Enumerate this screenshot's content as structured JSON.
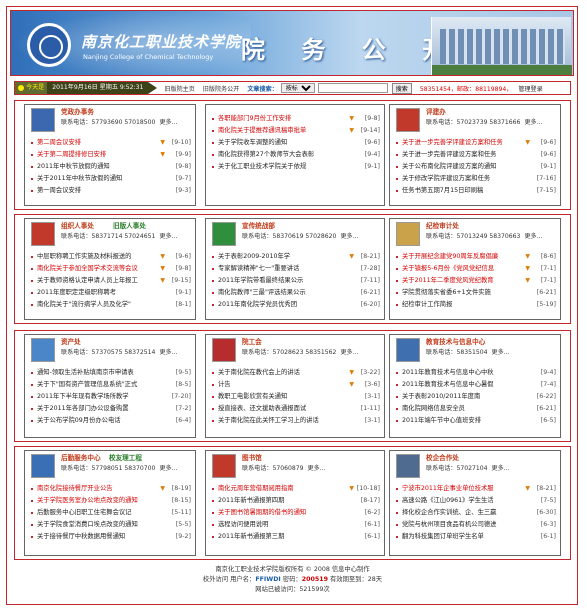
{
  "banner": {
    "school_cn": "南京化工职业技术学院",
    "school_en": "Nanjing College of Chemical Technology",
    "title": "院 务 公 开"
  },
  "navbar": {
    "today_label": "今天是",
    "date": "2011年9月16日 星期五 9:52:31",
    "links": [
      "旧版院主页",
      "旧版院务公开"
    ],
    "search_label": "文章搜索：",
    "select_value": "按标题",
    "search_button": "搜索",
    "stats": "58351454，邮政：88119894，",
    "admin": "管理登录"
  },
  "panels": [
    {
      "id": "a",
      "title": "党政办事务",
      "phone": "联系电话：57793690  57018500",
      "more": "更多...",
      "items": [
        {
          "t": "第二周会议安排",
          "d": "[9-10]",
          "hot": true,
          "flag": true
        },
        {
          "t": "关于第二周提排修日安排",
          "d": "[9-9]",
          "hot": true,
          "flag": true
        },
        {
          "t": "2011年中秋节放假的通知",
          "d": "[9-8]",
          "hot": false,
          "flag": false
        },
        {
          "t": "关于2011年中秋节放假的通知",
          "d": "[9-7]",
          "hot": false,
          "flag": false
        },
        {
          "t": "第一周会议安排",
          "d": "[9-3]",
          "hot": false,
          "flag": false
        }
      ]
    },
    {
      "id": "b",
      "title": "",
      "phone": "",
      "more": "",
      "items": [
        {
          "t": "各职能部门9月份工作安排",
          "d": "[9-8]",
          "hot": true,
          "flag": true
        },
        {
          "t": "南化院关于提推荐通讯稿审批单",
          "d": "[9-14]",
          "hot": true,
          "flag": true
        },
        {
          "t": "关于学院收车调整的通知",
          "d": "[9-6]",
          "hot": false,
          "flag": false
        },
        {
          "t": "南化院获得第27个教师节大会表彰",
          "d": "[9-4]",
          "hot": false,
          "flag": false
        },
        {
          "t": "关于化工职业技术学院关于依规",
          "d": "[9-1]",
          "hot": false,
          "flag": false
        }
      ]
    },
    {
      "id": "c",
      "title": "评建办",
      "phone": "联系电话：57023739  58371666",
      "more": "更多...",
      "items": [
        {
          "t": "关于进一步完善学评建设方案和任务",
          "d": "[9-6]",
          "hot": true,
          "flag": true
        },
        {
          "t": "关于进一步完善评建设方案和任务",
          "d": "[9-6]",
          "hot": false,
          "flag": false
        },
        {
          "t": "关于公布南化院评建设方案的通知",
          "d": "[9-1]",
          "hot": false,
          "flag": false
        },
        {
          "t": "关于修改学院评建设方案和任务",
          "d": "[7-16]",
          "hot": false,
          "flag": false
        },
        {
          "t": "任务书第五期7月15日印刷稿",
          "d": "[7-15]",
          "hot": false,
          "flag": false
        }
      ]
    },
    {
      "id": "d",
      "title": "组织人事处",
      "title2": "旧版人事处",
      "phone": "联系电话：58371714  57024651",
      "more": "更多...",
      "items": [
        {
          "t": "中层职称聘工作实施及材料报送的",
          "d": "[9-6]",
          "hot": false,
          "flag": true
        },
        {
          "t": "南化院关于参加全国学术交流等会议",
          "d": "[9-8]",
          "hot": true,
          "flag": true
        },
        {
          "t": "关于教师资格认定申请人员上年报工",
          "d": "[9-15]",
          "hot": false,
          "flag": true
        },
        {
          "t": "2011年度职定定级职称聘考",
          "d": "[9-1]",
          "hot": false,
          "flag": false
        },
        {
          "t": "南化院关于\"流行病学人员及化学\"",
          "d": "[8-1]",
          "hot": false,
          "flag": false
        }
      ]
    },
    {
      "id": "e",
      "title": "宣传统战部",
      "phone": "联系电话：58370619  57028620",
      "more": "更多...",
      "items": [
        {
          "t": "关于表彰2009-2010年学",
          "d": "[8-21]",
          "hot": false,
          "flag": true
        },
        {
          "t": "专家解读精神\"七一\"重要讲话",
          "d": "[7-28]",
          "hot": false,
          "flag": false
        },
        {
          "t": "2011年学院带看最终结果公示",
          "d": "[7-11]",
          "hot": false,
          "flag": false
        },
        {
          "t": "南化院教师\"三最\"评选结果公示",
          "d": "[6-21]",
          "hot": false,
          "flag": false
        },
        {
          "t": "2011年南化院学党员优秀团",
          "d": "[6-20]",
          "hot": false,
          "flag": false
        }
      ]
    },
    {
      "id": "f",
      "title": "纪检审计处",
      "phone": "联系电话：57013249  58370663",
      "more": "更多...",
      "items": [
        {
          "t": "关于开展纪念建党90周年反腐倡廉",
          "d": "[8-6]",
          "hot": true,
          "flag": true
        },
        {
          "t": "关于镇报5-6月份《党风党纪信息",
          "d": "[7-1]",
          "hot": true,
          "flag": true
        },
        {
          "t": "关于2011年二季度党风党纪教育",
          "d": "[7-1]",
          "hot": true,
          "flag": true
        },
        {
          "t": "学院贯彻落实省委6+1文件实施",
          "d": "[6-21]",
          "hot": false,
          "flag": false
        },
        {
          "t": "纪检审计工作简报",
          "d": "[5-19]",
          "hot": false,
          "flag": false
        }
      ]
    },
    {
      "id": "g",
      "title": "资产处",
      "phone": "联系电话：57370575  58372514",
      "more": "更多...",
      "items": [
        {
          "t": "通知-领取生活补贴填南京市申请表",
          "d": "[9-5]",
          "hot": false,
          "flag": false
        },
        {
          "t": "关于下\"国有资产管理信息系统\"正式",
          "d": "[8-5]",
          "hot": false,
          "flag": false
        },
        {
          "t": "2011年下半年现有教学场所教学",
          "d": "[7-20]",
          "hot": false,
          "flag": false
        },
        {
          "t": "关于2011年各部门办公设备购置",
          "d": "[7-2]",
          "hot": false,
          "flag": false
        },
        {
          "t": "关于公布学院09月份办公电话",
          "d": "[6-4]",
          "hot": false,
          "flag": false
        }
      ]
    },
    {
      "id": "h",
      "title": "院工会",
      "phone": "联系电话：57028623  58351562",
      "more": "更多...",
      "items": [
        {
          "t": "关于南化院在教代会上的讲话",
          "d": "[3-22]",
          "hot": false,
          "flag": true
        },
        {
          "t": "计告",
          "d": "[3-6]",
          "hot": false,
          "flag": true
        },
        {
          "t": "教职工电影欣赏有关通知",
          "d": "[3-1]",
          "hot": false,
          "flag": false
        },
        {
          "t": "授直接表、还文援助表通报面试",
          "d": "[1-11]",
          "hot": false,
          "flag": false
        },
        {
          "t": "关于南化院在此关怀工学习上的讲话",
          "d": "[3-1]",
          "hot": false,
          "flag": false
        }
      ]
    },
    {
      "id": "i",
      "title": "教育技术与信息中心",
      "phone": "联系电话：58351504",
      "more": "更多...",
      "items": [
        {
          "t": "2011年教育技术与信息中心中秋",
          "d": "[9-4]",
          "hot": false,
          "flag": false
        },
        {
          "t": "2011年教育技术与信息中心暑假",
          "d": "[7-4]",
          "hot": false,
          "flag": false
        },
        {
          "t": "关于表彰2010/2011年度南",
          "d": "[6-22]",
          "hot": false,
          "flag": false
        },
        {
          "t": "南化院网络信息安全员",
          "d": "[6-21]",
          "hot": false,
          "flag": false
        },
        {
          "t": "2011年端午节中心值班安排",
          "d": "[6-5]",
          "hot": false,
          "flag": false
        }
      ]
    },
    {
      "id": "j",
      "title": "后勤服务中心",
      "title2": "校友理工程",
      "phone": "联系电话：57798051  58370700",
      "more": "更多...",
      "items": [
        {
          "t": "南京化院接待餐厅开业公告",
          "d": "[8-19]",
          "hot": true,
          "flag": true
        },
        {
          "t": "关于学院医务室办公地点改变的通知",
          "d": "[8-15]",
          "hot": true,
          "flag": false
        },
        {
          "t": "后勤服务中心旧职工住宅舞会议记",
          "d": "[5-11]",
          "hot": false,
          "flag": false
        },
        {
          "t": "关于学院食堂消费口埃点改变的通知",
          "d": "[5-5]",
          "hot": false,
          "flag": false
        },
        {
          "t": "关于接待餐厅中秋数据用餐通知",
          "d": "[9-2]",
          "hot": false,
          "flag": false
        }
      ]
    },
    {
      "id": "k",
      "title": "图书馆",
      "phone": "联系电话：57060879",
      "more": "更多...",
      "items": [
        {
          "t": "南化元周年营借期阅用指南",
          "d": "[10-18]",
          "hot": true,
          "flag": true
        },
        {
          "t": "2011年新书通报第四期",
          "d": "[8-17]",
          "hot": false,
          "flag": false
        },
        {
          "t": "关于图书馆暑期期的借书的通知",
          "d": "[6-2]",
          "hot": true,
          "flag": false
        },
        {
          "t": "选程访问便用说明",
          "d": "[6-1]",
          "hot": false,
          "flag": false
        },
        {
          "t": "2011年新书通报第三期",
          "d": "[6-1]",
          "hot": false,
          "flag": false
        }
      ]
    },
    {
      "id": "l",
      "title": "校企合作处",
      "phone": "联系电话：57027104",
      "more": "更多...",
      "items": [
        {
          "t": "宁波市2011年企事业单位技术服",
          "d": "[8-21]",
          "hot": true,
          "flag": true
        },
        {
          "t": "高速公路《江山0961》学生生活",
          "d": "[7-5]",
          "hot": false,
          "flag": false
        },
        {
          "t": "择化校企合作实训统、企、生三赢",
          "d": "[6-30]",
          "hot": false,
          "flag": false
        },
        {
          "t": "党院与杭州项目食品有机公司德进",
          "d": "[6-3]",
          "hot": false,
          "flag": false
        },
        {
          "t": "翻为科技集团订单班学生名单",
          "d": "[6-1]",
          "hot": false,
          "flag": false
        }
      ]
    }
  ],
  "footer": {
    "line1": "南京化工职业技术学院版权所有 © 2008 信息中心制作",
    "visit_label": "校外访问 用户名：",
    "user": "FFIWDI",
    "pw_label": " 密码：",
    "pw": "200519",
    "valid": " 有效期至到：28天",
    "line3": "网站已被访问：521599次"
  }
}
